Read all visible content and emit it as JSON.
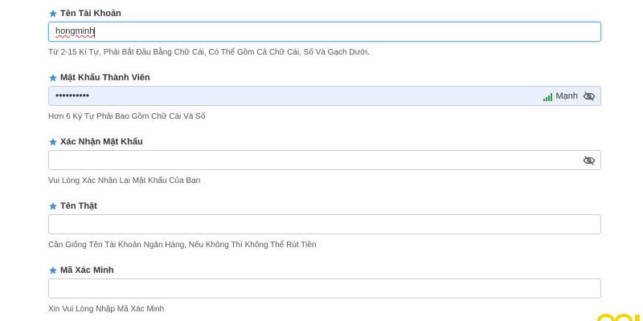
{
  "form": {
    "fields": [
      {
        "label": "Tên Tài Khoản",
        "value": "hongminh",
        "hint": "Từ 2-15 Kí Tự, Phải Bắt Đầu Bằng Chữ Cái, Có Thể Gồm Cả Chữ Cái, Số Và Gạch Dưới."
      },
      {
        "label": "Mật Khẩu Thành Viên",
        "value": "••••••••••",
        "strength_label": "Mạnh",
        "hint": "Hơn 6 Ký Tự Phải Bao Gồm Chữ Cái Và Số"
      },
      {
        "label": "Xác Nhận Mật Khẩu",
        "value": "",
        "hint": "Vui Lòng Xác Nhận Lại Mật Khẩu Của Bạn"
      },
      {
        "label": "Tên Thật",
        "value": "",
        "hint": "Cần Giống Tên Tài Khoản Ngân Hàng, Nếu Không Thì Không Thể Rút Tiền"
      },
      {
        "label": "Mã Xác Minh",
        "value": "",
        "hint": "Xin Vui Lòng Nhập Mã Xác Minh"
      }
    ],
    "icons": {
      "required": "star-icon",
      "toggle_visibility": "eye-slash-icon",
      "strength": "signal-bars-icon"
    }
  },
  "colors": {
    "star": "#3d8fd6",
    "focus_border": "#66afe9",
    "autofill_bg": "#e8f0fe",
    "strength": "#2e9e3a",
    "accent_corner": "#f5d400"
  }
}
